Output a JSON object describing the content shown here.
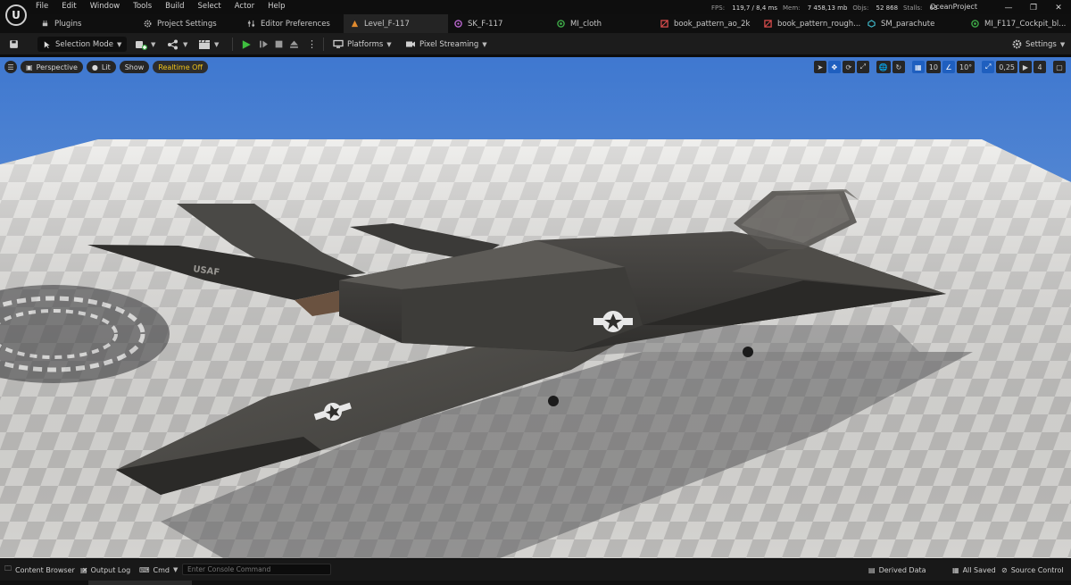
{
  "menu": [
    "File",
    "Edit",
    "Window",
    "Tools",
    "Build",
    "Select",
    "Actor",
    "Help"
  ],
  "stats": {
    "fps_label": "FPS:",
    "fps_value": "119,7 / 8,4 ms",
    "mem_label": "Mem:",
    "mem_value": "7 458,13 mb",
    "objs_label": "Objs:",
    "objs_value": "52 868",
    "stalls_label": "Stalls:",
    "stalls_value": "63"
  },
  "project_name": "OceanProject",
  "tabs": [
    {
      "label": "Plugins",
      "icon": "plug-icon",
      "color": "#bbbbbb"
    },
    {
      "label": "Project Settings",
      "icon": "gear-icon",
      "color": "#bbbbbb"
    },
    {
      "label": "Editor Preferences",
      "icon": "sliders-icon",
      "color": "#bbbbbb"
    },
    {
      "label": "Level_F-117",
      "icon": "level-icon",
      "color": "#e08a2e"
    },
    {
      "label": "SK_F-117",
      "icon": "skeleton-icon",
      "color": "#c06ad6"
    },
    {
      "label": "MI_cloth",
      "icon": "material-icon",
      "color": "#3fae49"
    },
    {
      "label": "book_pattern_ao_2k",
      "icon": "texture-icon",
      "color": "#d94c4c"
    },
    {
      "label": "book_pattern_rough...",
      "icon": "texture-icon",
      "color": "#d94c4c"
    },
    {
      "label": "SM_parachute",
      "icon": "static-mesh-icon",
      "color": "#3fb8c9"
    },
    {
      "label": "MI_F117_Cockpit_bl...",
      "icon": "material-icon",
      "color": "#3fae49"
    }
  ],
  "toolbar": {
    "selection_mode": "Selection Mode",
    "platforms": "Platforms",
    "pixel_streaming": "Pixel Streaming",
    "settings": "Settings"
  },
  "viewport": {
    "perspective": "Perspective",
    "lit": "Lit",
    "show": "Show",
    "realtime": "Realtime Off",
    "grid_snap": "10",
    "rot_snap": "10°",
    "scale_snap": "0,25",
    "camera_speed": "4",
    "fuselage_text": "USAF"
  },
  "bottom": {
    "content_browser": "Content Browser",
    "output_log": "Output Log",
    "cmd": "Cmd",
    "console_placeholder": "Enter Console Command",
    "derived_data": "Derived Data",
    "all_saved": "All Saved",
    "source_control": "Source Control"
  }
}
